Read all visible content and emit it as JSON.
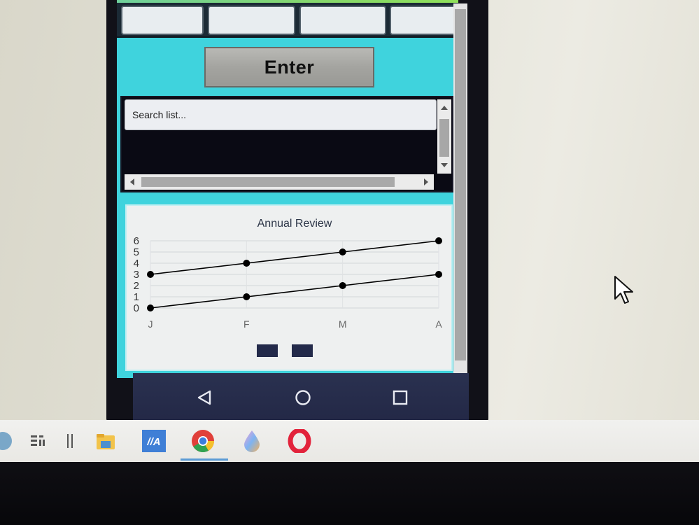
{
  "app": {
    "enter_button": "Enter",
    "search": {
      "placeholder": "Search list...",
      "value": ""
    }
  },
  "chart_data": {
    "type": "line",
    "title": "Annual Review",
    "categories": [
      "J",
      "F",
      "M",
      "A"
    ],
    "y_ticks": [
      "0",
      "1",
      "2",
      "3",
      "4",
      "5",
      "6"
    ],
    "ylim": [
      0,
      6
    ],
    "grid": true,
    "legend": "bottom",
    "series": [
      {
        "values": [
          3,
          4,
          5,
          6
        ],
        "color": "#000000"
      },
      {
        "values": [
          0,
          1,
          2,
          3
        ],
        "color": "#000000"
      }
    ],
    "legend_swatch_color": "#232a4a"
  },
  "navbar": {
    "buttons": [
      "back-icon",
      "home-icon",
      "recents-icon"
    ]
  },
  "taskbar": {
    "icons": [
      "task-view-icon",
      "divider-icon",
      "file-explorer-icon",
      "app-ma-icon",
      "chrome-icon",
      "paint-drop-icon",
      "opera-icon"
    ],
    "app_ma_text": "//A"
  }
}
